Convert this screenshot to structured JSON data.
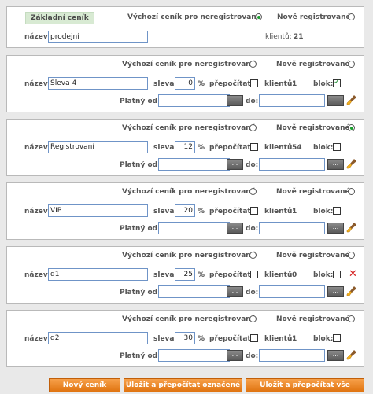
{
  "labels": {
    "default_unregistered": "Výchozí ceník pro neregistrované",
    "newly_registered": "Nově registrované",
    "name": "název:",
    "discount": "sleva:",
    "percent": "%",
    "recalculate": "přepočítat:",
    "clients": "klientů:",
    "block": "blok:",
    "valid_from": "Platný od:",
    "to": "do:",
    "cal_btn": "..."
  },
  "base": {
    "badge": "Základní ceník",
    "name": "prodejní",
    "clients_label": "klientů:",
    "clients": "21",
    "default_selected": true,
    "new_selected": false
  },
  "pricelists": [
    {
      "name": "Sleva 4",
      "discount": "0",
      "clients": "1",
      "block": true,
      "default_selected": false,
      "new_selected": false,
      "delete": false
    },
    {
      "name": "Registrovaní",
      "discount": "12",
      "clients": "54",
      "block": false,
      "default_selected": false,
      "new_selected": true,
      "delete": false
    },
    {
      "name": "VIP",
      "discount": "20",
      "clients": "1",
      "block": false,
      "default_selected": false,
      "new_selected": false,
      "delete": false
    },
    {
      "name": "d1",
      "discount": "25",
      "clients": "0",
      "block": false,
      "default_selected": false,
      "new_selected": false,
      "delete": true
    },
    {
      "name": "d2",
      "discount": "30",
      "clients": "1",
      "block": false,
      "default_selected": false,
      "new_selected": false,
      "delete": false
    }
  ],
  "buttons": {
    "new": "Nový ceník",
    "save_marked": "Uložit a přepočítat označené",
    "save_all": "Uložit a přepočítat vše"
  }
}
